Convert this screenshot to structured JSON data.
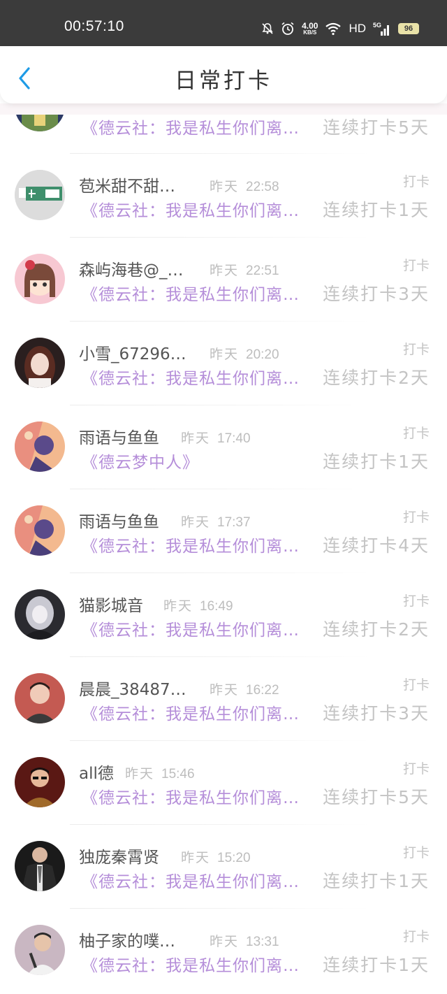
{
  "status_bar": {
    "time": "00:57:10",
    "net_speed_value": "4.00",
    "net_speed_unit": "KB/S",
    "network_type": "HD",
    "signal_label": "5G",
    "battery": "96"
  },
  "header": {
    "title": "日常打卡",
    "back_icon": "chevron-left-icon"
  },
  "colors": {
    "status_bar_bg": "#3b3b3b",
    "book_title": "#b58ed9",
    "streak_text": "#c4c4c4",
    "back_icon": "#1e9be6"
  },
  "top_partial": {
    "book": "《德云社：我是私生你们离…",
    "streak": "连续打卡5天"
  },
  "entries": [
    {
      "name": "苞米甜不甜…",
      "date": "昨天",
      "time": "22:58",
      "tag": "打卡",
      "book": "《德云社：我是私生你们离…",
      "streak": "连续打卡1天",
      "avatar": "exit-sign-avatar"
    },
    {
      "name": "森屿海巷@_…",
      "date": "昨天",
      "time": "22:51",
      "tag": "打卡",
      "book": "《德云社：我是私生你们离…",
      "streak": "连续打卡3天",
      "avatar": "cartoon-girl-avatar"
    },
    {
      "name": "小雪_67296…",
      "date": "昨天",
      "time": "20:20",
      "tag": "打卡",
      "book": "《德云社：我是私生你们离…",
      "streak": "连续打卡2天",
      "avatar": "girl-photo-avatar"
    },
    {
      "name": "雨语与鱼鱼",
      "date": "昨天",
      "time": "17:40",
      "tag": "打卡",
      "book": "《德云梦中人》",
      "streak": "连续打卡1天",
      "avatar": "anime-avatar"
    },
    {
      "name": "雨语与鱼鱼",
      "date": "昨天",
      "time": "17:37",
      "tag": "打卡",
      "book": "《德云社：我是私生你们离…",
      "streak": "连续打卡4天",
      "avatar": "anime-avatar"
    },
    {
      "name": "猫影城音",
      "date": "昨天",
      "time": "16:49",
      "tag": "打卡",
      "book": "《德云社：我是私生你们离…",
      "streak": "连续打卡2天",
      "avatar": "dark-anime-avatar"
    },
    {
      "name": "晨晨_38487…",
      "date": "昨天",
      "time": "16:22",
      "tag": "打卡",
      "book": "《德云社：我是私生你们离…",
      "streak": "连续打卡3天",
      "avatar": "man-photo-avatar"
    },
    {
      "name": "all德",
      "date": "昨天",
      "time": "15:46",
      "tag": "打卡",
      "book": "《德云社：我是私生你们离…",
      "streak": "连续打卡5天",
      "avatar": "man-glasses-avatar"
    },
    {
      "name": "独庞秦霄贤",
      "date": "昨天",
      "time": "15:20",
      "tag": "打卡",
      "book": "《德云社：我是私生你们离…",
      "streak": "连续打卡1天",
      "avatar": "suit-photo-avatar"
    },
    {
      "name": "柚子家的噗…",
      "date": "昨天",
      "time": "13:31",
      "tag": "打卡",
      "book": "《德云社：我是私生你们离…",
      "streak": "连续打卡1天",
      "avatar": "singer-photo-avatar"
    }
  ]
}
